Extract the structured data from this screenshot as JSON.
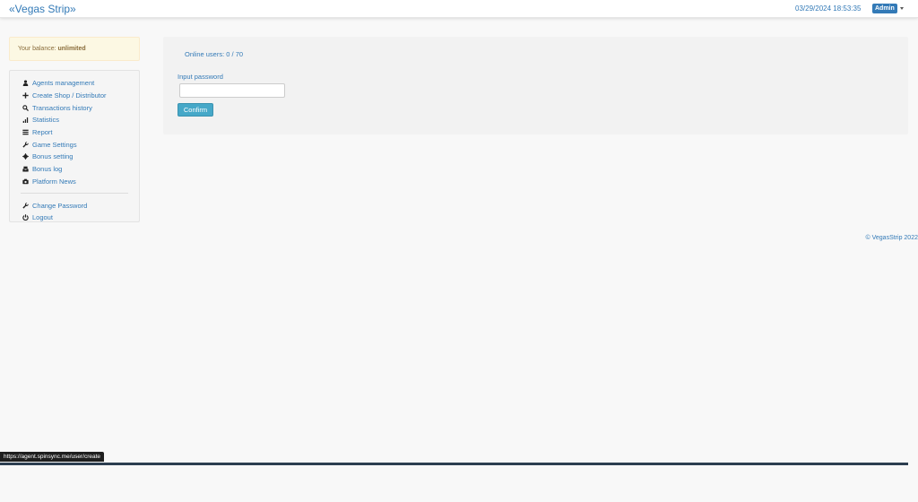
{
  "navbar": {
    "brand": "«Vegas Strip»",
    "datetime": "03/29/2024 18:53:35",
    "user_badge": "Admin"
  },
  "balance": {
    "label": "Your balance: ",
    "value": "unlimited"
  },
  "sidebar": {
    "items": [
      {
        "label": "Agents management",
        "icon": "user-icon"
      },
      {
        "label": "Create Shop / Distributor",
        "icon": "plus-icon"
      },
      {
        "label": "Transactions history",
        "icon": "search-icon"
      },
      {
        "label": "Statistics",
        "icon": "signal-icon"
      },
      {
        "label": "Report",
        "icon": "list-icon"
      },
      {
        "label": "Game Settings",
        "icon": "wrench-icon"
      },
      {
        "label": "Bonus setting",
        "icon": "gear-icon"
      },
      {
        "label": "Bonus log",
        "icon": "inbox-icon"
      },
      {
        "label": "Platform News",
        "icon": "camera-icon"
      }
    ],
    "account_items": [
      {
        "label": "Change Password",
        "icon": "wrench-icon"
      },
      {
        "label": "Logout",
        "icon": "power-icon"
      }
    ]
  },
  "main": {
    "online_users": "Online users: 0 / 70",
    "password_label": "Input password",
    "password_value": "",
    "confirm_label": "Confirm"
  },
  "footer": {
    "copyright": "© VegasStrip 2022"
  },
  "statusbar": {
    "url": "https://agent.spinsync.me/user/create"
  }
}
